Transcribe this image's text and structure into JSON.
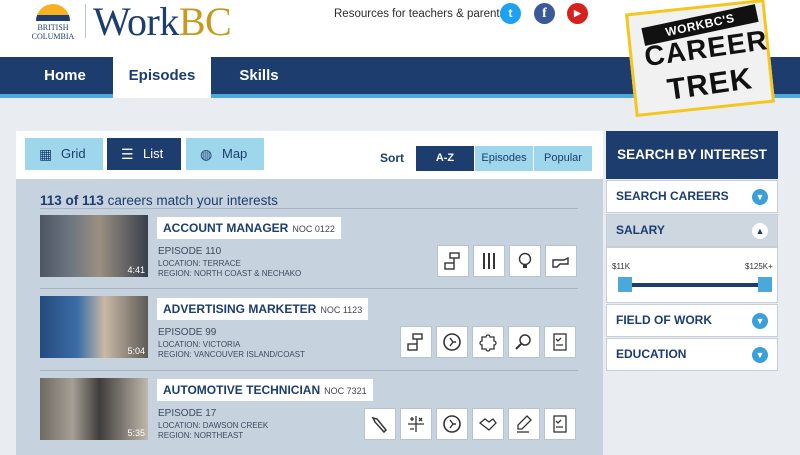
{
  "header": {
    "bc_logo_text": [
      "BRITISH",
      "COLUMBIA"
    ],
    "brand_work": "Work",
    "brand_bc": "BC",
    "resources_text": "Resources for teachers & parents",
    "social": [
      {
        "name": "twitter",
        "glyph": "t"
      },
      {
        "name": "facebook",
        "glyph": "f"
      },
      {
        "name": "youtube",
        "glyph": "▶"
      }
    ]
  },
  "nav": {
    "items": [
      {
        "label": "Home",
        "active": false
      },
      {
        "label": "Episodes",
        "active": true
      },
      {
        "label": "Skills",
        "active": false
      }
    ]
  },
  "badge": {
    "line1": "WORKBC'S",
    "line2": "CAREER",
    "line3": "TREK"
  },
  "view_modes": {
    "grid": "Grid",
    "list": "List",
    "map": "Map",
    "active": "List"
  },
  "sort": {
    "label": "Sort",
    "options": [
      "A-Z",
      "Episodes",
      "Popular"
    ],
    "active": "A-Z"
  },
  "results": {
    "count_shown": "113 of 113",
    "count_suffix": "careers match your interests"
  },
  "careers": [
    {
      "title": "ACCOUNT MANAGER",
      "noc": "NOC 0122",
      "episode": "EPISODE 110",
      "location": "LOCATION: TERRACE",
      "region": "REGION: NORTH COAST & NECHAKO",
      "duration": "4:41",
      "skills": [
        "flowchart-icon",
        "tools-icon",
        "lightbulb-icon",
        "pointing-hand-icon"
      ]
    },
    {
      "title": "ADVERTISING MARKETER",
      "noc": "NOC 1123",
      "episode": "EPISODE 99",
      "location": "LOCATION: VICTORIA",
      "region": "REGION: VANCOUVER ISLAND/COAST",
      "duration": "5:04",
      "skills": [
        "flowchart-icon",
        "running-person-icon",
        "puzzle-icon",
        "magnifier-icon",
        "checklist-icon"
      ]
    },
    {
      "title": "AUTOMOTIVE TECHNICIAN",
      "noc": "NOC 7321",
      "episode": "EPISODE 17",
      "location": "LOCATION: DAWSON CREEK",
      "region": "REGION: NORTHEAST",
      "duration": "5:35",
      "skills": [
        "wrench-icon",
        "math-symbols-icon",
        "running-person-icon",
        "handshake-icon",
        "pen-hand-icon",
        "checklist-icon"
      ]
    }
  ],
  "sidebar": {
    "title": "SEARCH BY INTEREST",
    "sections": [
      {
        "label": "SEARCH CAREERS",
        "expanded": false
      },
      {
        "label": "SALARY",
        "expanded": true
      },
      {
        "label": "FIELD OF WORK",
        "expanded": false
      },
      {
        "label": "EDUCATION",
        "expanded": false
      }
    ],
    "salary_min": "$11K",
    "salary_max": "$125K+",
    "salary_range_fraction": [
      0,
      1
    ]
  },
  "colors": {
    "navy": "#1c3d6e",
    "light_blue": "#9ed6ec",
    "accent_blue": "#4aa9d8",
    "gold": "#c79a1f"
  }
}
